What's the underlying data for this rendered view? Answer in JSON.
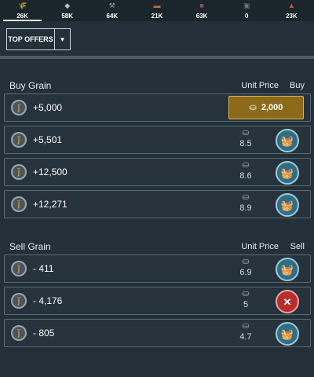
{
  "resources": [
    {
      "icon": "grain-icon",
      "amount": "26K",
      "color": "#f0b430",
      "active": true
    },
    {
      "icon": "stone-icon",
      "amount": "58K",
      "color": "#b8c1c6",
      "active": false
    },
    {
      "icon": "iron-icon",
      "amount": "64K",
      "color": "#8d9aa2",
      "active": false
    },
    {
      "icon": "wood-icon",
      "amount": "21K",
      "color": "#c56a3a",
      "active": false
    },
    {
      "icon": "leather-icon",
      "amount": "63K",
      "color": "#8a5a4a",
      "active": false
    },
    {
      "icon": "cloth-icon",
      "amount": "0",
      "color": "#6a7680",
      "active": false
    },
    {
      "icon": "fire-icon",
      "amount": "23K",
      "color": "#e04a3a",
      "active": false
    }
  ],
  "filter": {
    "label": "TOP OFFERS"
  },
  "buy": {
    "title": "Buy Grain",
    "col_price": "Unit Price",
    "col_action": "Buy",
    "rows": [
      {
        "qty": "+5,000",
        "price": "2,000",
        "button": "gold"
      },
      {
        "qty": "+5,501",
        "price": "8.5",
        "button": "buy"
      },
      {
        "qty": "+12,500",
        "price": "8.6",
        "button": "buy"
      },
      {
        "qty": "+12,271",
        "price": "8.9",
        "button": "buy"
      }
    ]
  },
  "sell": {
    "title": "Sell Grain",
    "col_price": "Unit Price",
    "col_action": "Sell",
    "rows": [
      {
        "qty": "- 411",
        "price": "6.9",
        "button": "buy"
      },
      {
        "qty": "- 4,176",
        "price": "5",
        "button": "cancel"
      },
      {
        "qty": "- 805",
        "price": "4.7",
        "button": "buy"
      }
    ]
  }
}
